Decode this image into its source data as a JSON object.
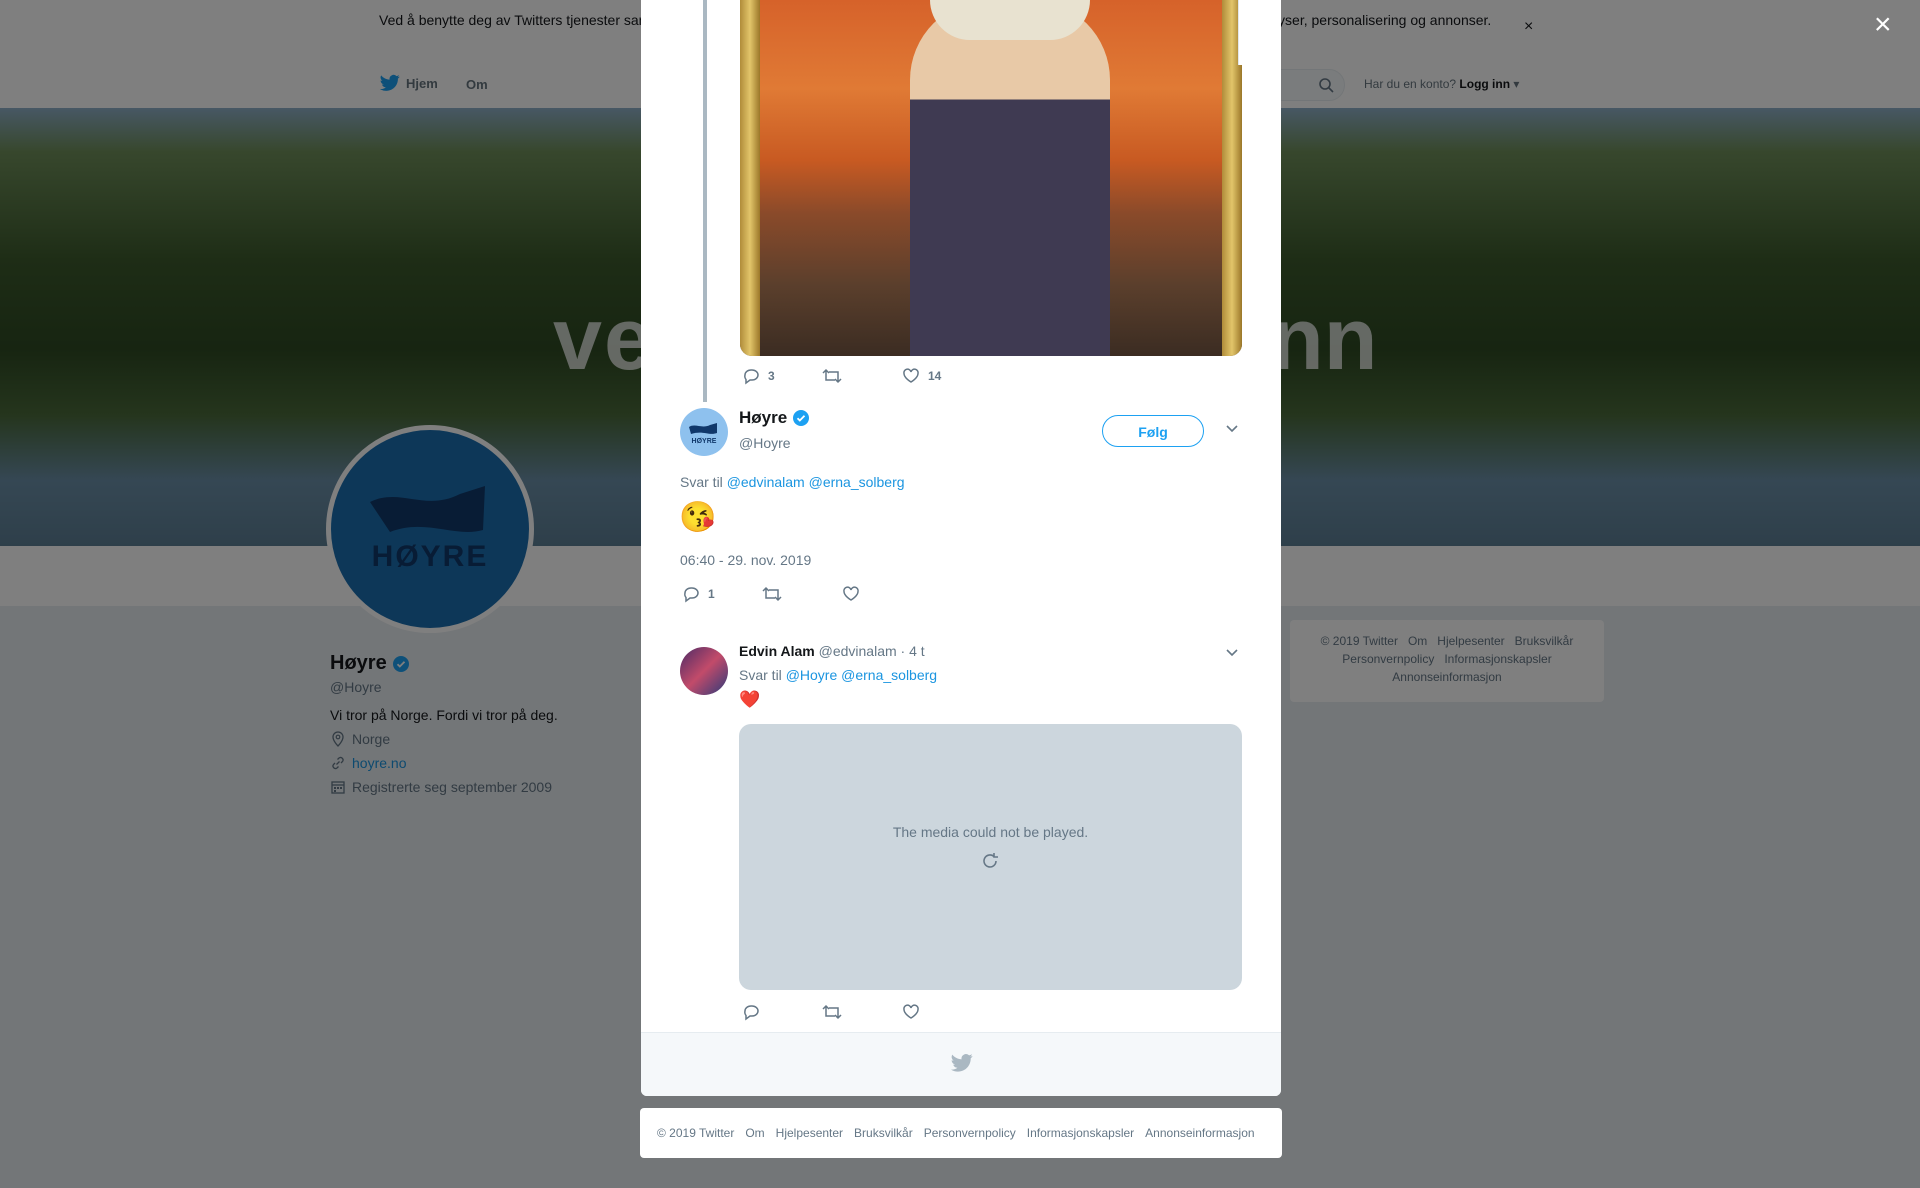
{
  "cookie_banner": {
    "text": "Ved å benytte deg av Twitters tjenester samtykker du i bruken av informasjonskapsler. Twitter og partnere bruker informasjonskapsler til bl.a. analyser, personalisering og annonser.",
    "close": "×"
  },
  "nav": {
    "home": "Hjem",
    "about": "Om",
    "login_prompt": "Har du en konto?",
    "login": "Logg inn"
  },
  "banner": {
    "text_left": "ve",
    "text_right": "nn"
  },
  "profile": {
    "avatar_text": "HØYRE",
    "name": "Høyre",
    "handle": "@Hoyre",
    "bio": "Vi tror på Norge. Fordi vi tror på deg.",
    "location": "Norge",
    "website": "hoyre.no",
    "joined": "Registrerte seg september 2009"
  },
  "side_footer": {
    "links_row1": [
      "© 2019 Twitter",
      "Om",
      "Hjelpesenter",
      "Bruksvilkår"
    ],
    "links_row2": [
      "Personvernpolicy",
      "Informasjonskapsler"
    ],
    "links_row3": [
      "Annonseinformasjon"
    ]
  },
  "modal": {
    "close": "×",
    "parent_tweet": {
      "replies": "3",
      "likes": "14"
    },
    "focused_tweet": {
      "avatar_text": "HØYRE",
      "name": "Høyre",
      "handle": "@Hoyre",
      "follow": "Følg",
      "reply_prefix": "Svar til",
      "reply_mention1": "@edvinalam",
      "reply_mention2": "@erna_solberg",
      "emoji": "😘",
      "timestamp": "06:40 - 29. nov. 2019",
      "replies": "1"
    },
    "reply_tweet": {
      "name": "Edvin Alam",
      "handle": "@edvinalam",
      "time": "· 4 t",
      "reply_prefix": "Svar til",
      "reply_mention1": "@Hoyre",
      "reply_mention2": "@erna_solberg",
      "emoji": "❤️",
      "media_error": "The media could not be played."
    }
  },
  "bottom_footer": [
    "© 2019 Twitter",
    "Om",
    "Hjelpesenter",
    "Bruksvilkår",
    "Personvernpolicy",
    "Informasjonskapsler",
    "Annonseinformasjon"
  ]
}
